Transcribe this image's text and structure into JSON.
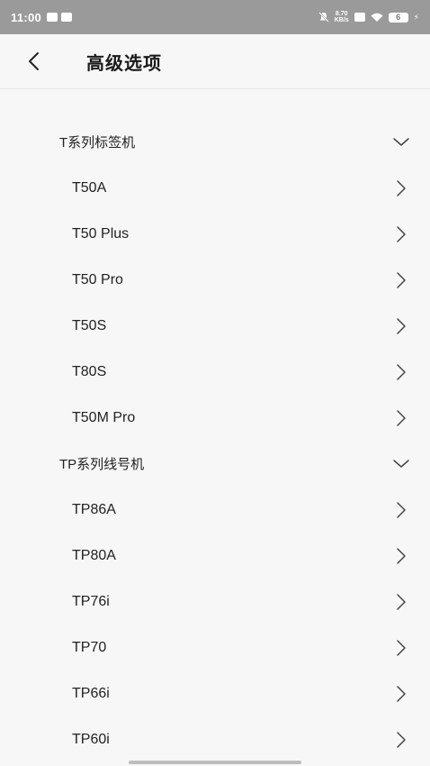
{
  "status_bar": {
    "time": "11:00",
    "net_speed_value": "8.70",
    "net_speed_unit": "KB/s",
    "battery": "6"
  },
  "header": {
    "title": "高级选项"
  },
  "groups": [
    {
      "label": "T系列标签机",
      "items": [
        "T50A",
        "T50 Plus",
        "T50 Pro",
        "T50S",
        "T80S",
        "T50M Pro"
      ]
    },
    {
      "label": "TP系列线号机",
      "items": [
        "TP86A",
        "TP80A",
        "TP76i",
        "TP70",
        "TP66i",
        "TP60i"
      ]
    }
  ],
  "colors": {
    "status_bar_bg": "#9a9a9a",
    "page_bg": "#f7f7f7",
    "text": "#222222"
  },
  "icons": {
    "back": "chevron-left-icon",
    "group_expand": "chevron-down-icon",
    "item_arrow": "chevron-right-icon"
  }
}
